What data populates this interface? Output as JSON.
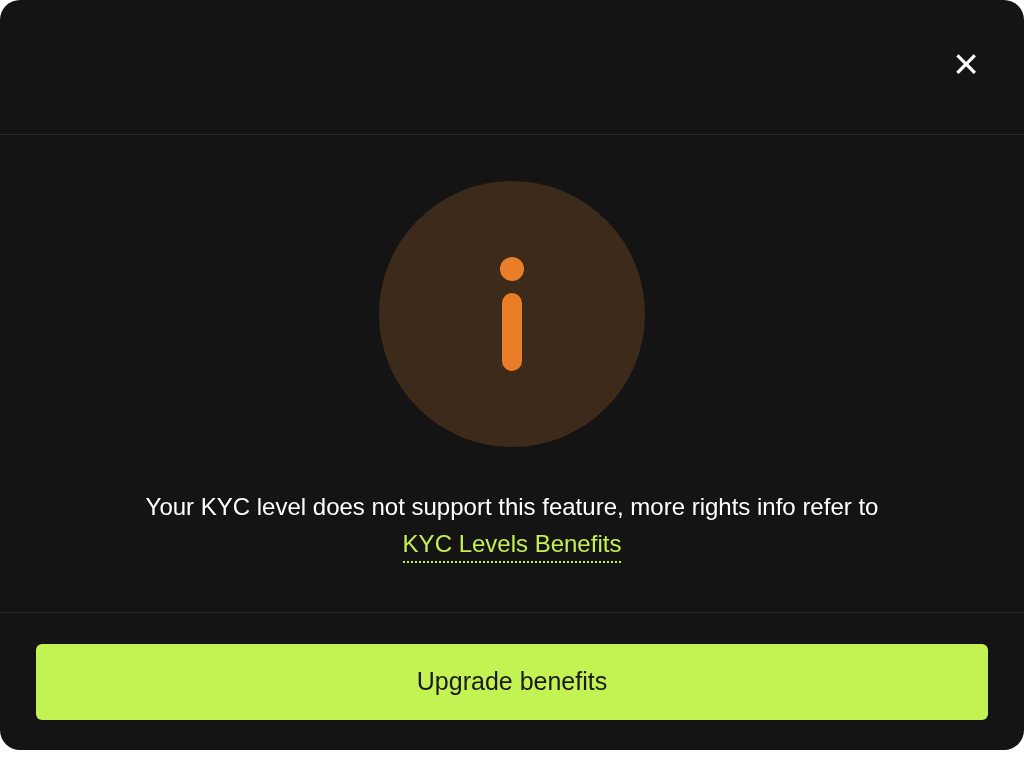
{
  "dialog": {
    "close": "×",
    "message": "Your KYC level does not support this feature, more rights info refer to",
    "link": "KYC Levels Benefits",
    "button": "Upgrade benefits"
  }
}
